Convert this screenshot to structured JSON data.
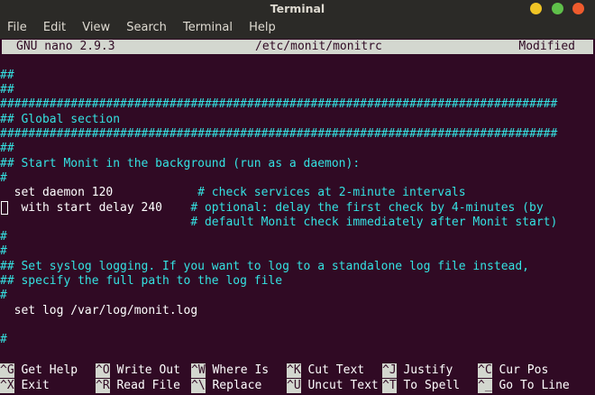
{
  "window": {
    "title": "Terminal",
    "menu": [
      "File",
      "Edit",
      "View",
      "Search",
      "Terminal",
      "Help"
    ]
  },
  "nano": {
    "app": "GNU nano 2.9.3",
    "file": "/etc/monit/monitrc",
    "status": "Modified"
  },
  "lines": [
    "",
    "##",
    "##",
    "###############################################################################",
    "## Global section",
    "###############################################################################",
    "##",
    "## Start Monit in the background (run as a daemon):",
    "#",
    "  set daemon 120            # check services at 2-minute intervals",
    "   with start delay 240    # optional: delay the first check by 4-minutes (by",
    "                           # default Monit check immediately after Monit start)",
    "#",
    "#",
    "## Set syslog logging. If you want to log to a standalone log file instead,",
    "## specify the full path to the log file",
    "#",
    "  set log /var/log/monit.log",
    "",
    "#"
  ],
  "shortcuts_row1": [
    {
      "key": "^G",
      "label": "Get Help"
    },
    {
      "key": "^O",
      "label": "Write Out"
    },
    {
      "key": "^W",
      "label": "Where Is"
    },
    {
      "key": "^K",
      "label": "Cut Text"
    },
    {
      "key": "^J",
      "label": "Justify"
    },
    {
      "key": "^C",
      "label": "Cur Pos"
    }
  ],
  "shortcuts_row2": [
    {
      "key": "^X",
      "label": "Exit"
    },
    {
      "key": "^R",
      "label": "Read File"
    },
    {
      "key": "^\\",
      "label": "Replace"
    },
    {
      "key": "^U",
      "label": "Uncut Text"
    },
    {
      "key": "^T",
      "label": "To Spell"
    },
    {
      "key": "^_",
      "label": "Go To Line"
    }
  ],
  "colors": {
    "background": "#300a24",
    "comment": "#34e2e2",
    "text": "#ffffff",
    "header_bg": "#d3d7cf"
  }
}
